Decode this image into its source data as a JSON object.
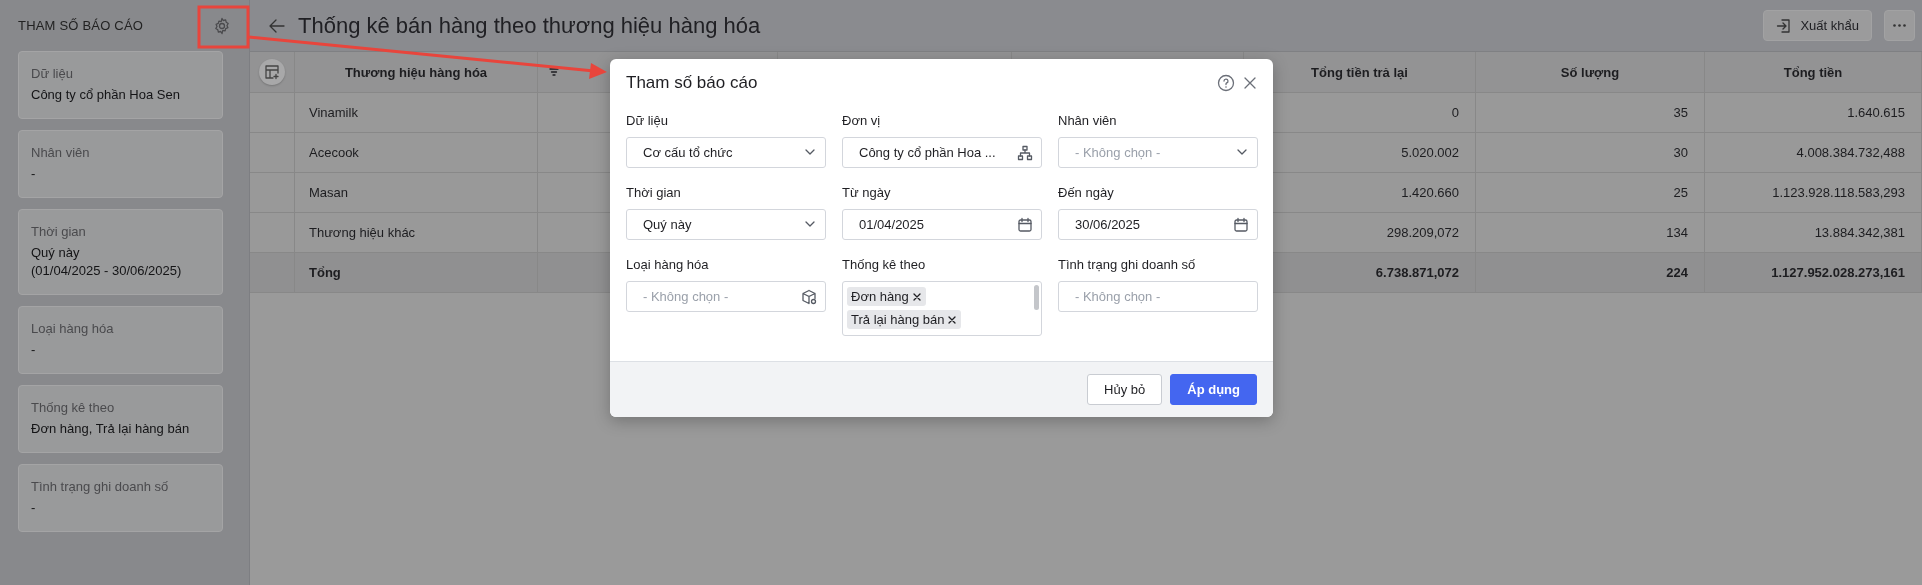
{
  "sidebar": {
    "title": "THAM SỐ BÁO CÁO",
    "params": [
      {
        "label": "Dữ liệu",
        "value": "Công ty cổ phần Hoa Sen"
      },
      {
        "label": "Nhân viên",
        "value": "-"
      },
      {
        "label": "Thời gian",
        "value": "Quý này\n(01/04/2025 - 30/06/2025)"
      },
      {
        "label": "Loại hàng hóa",
        "value": "-"
      },
      {
        "label": "Thống kê theo",
        "value": "Đơn hàng, Trả lại hàng bán"
      },
      {
        "label": "Tình trạng ghi doanh số",
        "value": "-"
      }
    ]
  },
  "header": {
    "title": "Thống kê bán hàng theo thương hiệu hàng hóa",
    "export_button": "Xuất khẩu"
  },
  "table": {
    "columns": [
      "Thương hiệu hàng hóa",
      "Tổng tiền trả lại",
      "Số lượng",
      "Tổng tiền"
    ],
    "rows": [
      {
        "kind": "item",
        "cells": [
          "Vinamilk",
          "0",
          "35",
          "1.640.615"
        ]
      },
      {
        "kind": "item",
        "cells": [
          "Acecook",
          "5.020.002",
          "30",
          "4.008.384.732,488"
        ]
      },
      {
        "kind": "item",
        "cells": [
          "Masan",
          "1.420.660",
          "25",
          "1.123.928.118.583,293"
        ]
      },
      {
        "kind": "item",
        "cells": [
          "Thương hiệu khác",
          "298.209,072",
          "134",
          "13.884.342,381"
        ]
      },
      {
        "kind": "total",
        "cells": [
          "Tổng",
          "6.738.871,072",
          "224",
          "1.127.952.028.273,161"
        ]
      }
    ]
  },
  "dialog": {
    "title": "Tham số báo cáo",
    "fields": [
      {
        "label": "Dữ liệu",
        "kind": "select",
        "value": "Cơ cấu tổ chức"
      },
      {
        "label": "Đơn vị",
        "kind": "tree",
        "value": "Công ty cổ phần Hoa ..."
      },
      {
        "label": "Nhân viên",
        "kind": "select",
        "placeholder": "- Không chọn -"
      },
      {
        "label": "Thời gian",
        "kind": "select",
        "value": "Quý này"
      },
      {
        "label": "Từ ngày",
        "kind": "date",
        "value": "01/04/2025"
      },
      {
        "label": "Đến ngày",
        "kind": "date",
        "value": "30/06/2025"
      },
      {
        "label": "Loại hàng hóa",
        "kind": "category",
        "placeholder": "- Không chọn -"
      },
      {
        "label": "Thống kê theo",
        "kind": "tags",
        "tags": [
          "Đơn hàng",
          "Trả lại hàng bán"
        ]
      },
      {
        "label": "Tình trạng ghi doanh số",
        "kind": "text",
        "placeholder": "- Không chọn -"
      }
    ],
    "buttons": [
      {
        "label": "Hủy bỏ",
        "primary": false
      },
      {
        "label": "Áp dụng",
        "primary": true
      }
    ]
  }
}
